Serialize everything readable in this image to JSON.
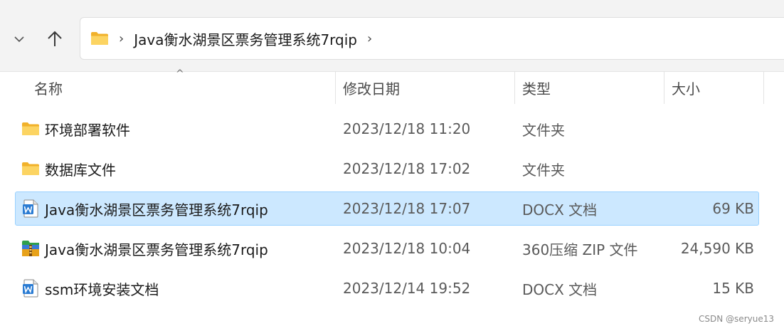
{
  "address": {
    "separator": "›",
    "crumb": "Java衡水湖景区票务管理系统7rqip",
    "chevron": "›"
  },
  "columns": {
    "name": "名称",
    "date": "修改日期",
    "type": "类型",
    "size": "大小"
  },
  "files": [
    {
      "icon": "folder-icon",
      "name": "环境部署软件",
      "date": "2023/12/18 11:20",
      "type": "文件夹",
      "size": ""
    },
    {
      "icon": "folder-icon",
      "name": "数据库文件",
      "date": "2023/12/18 17:02",
      "type": "文件夹",
      "size": ""
    },
    {
      "icon": "word-doc-icon",
      "name": "Java衡水湖景区票务管理系统7rqip",
      "date": "2023/12/18 17:07",
      "type": "DOCX 文档",
      "size": "69 KB",
      "selected": true
    },
    {
      "icon": "zip-archive-icon",
      "name": "Java衡水湖景区票务管理系统7rqip",
      "date": "2023/12/18 10:04",
      "type": "360压缩 ZIP 文件",
      "size": "24,590 KB"
    },
    {
      "icon": "word-doc-icon",
      "name": "ssm环境安装文档",
      "date": "2023/12/14 19:52",
      "type": "DOCX 文档",
      "size": "15 KB"
    }
  ],
  "watermark": "CSDN @seryue13",
  "colors": {
    "selection_bg": "#cce8ff",
    "selection_border": "#99d1ff",
    "folder_yellow": "#f8c74a",
    "word_blue": "#2b7cd3"
  }
}
